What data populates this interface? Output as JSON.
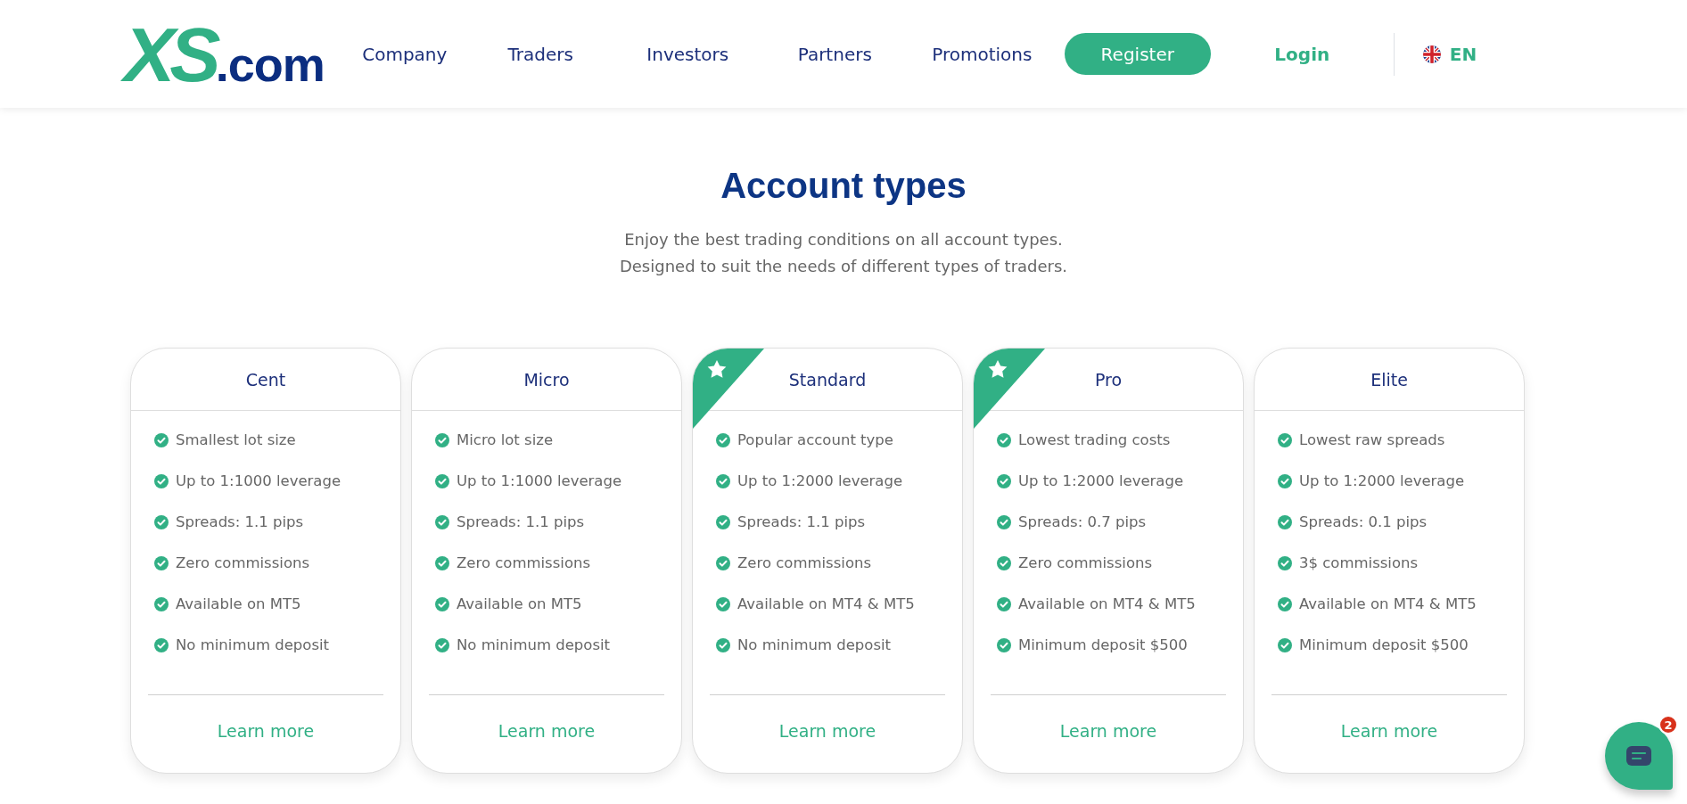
{
  "header": {
    "logo": {
      "mark": "XS",
      "suffix": ".com"
    },
    "nav": [
      "Company",
      "Traders",
      "Investors",
      "Partners",
      "Promotions"
    ],
    "register": "Register",
    "login": "Login",
    "language": "EN"
  },
  "section": {
    "title": "Account types",
    "subtitle": [
      "Enjoy the best trading conditions on all account types.",
      "Designed to suit the needs of different types of traders."
    ]
  },
  "cards": [
    {
      "name": "Cent",
      "featured": false,
      "features": [
        "Smallest lot size",
        "Up to 1:1000 leverage",
        "Spreads: 1.1 pips",
        "Zero commissions",
        "Available on MT5",
        "No minimum deposit"
      ],
      "link": "Learn more"
    },
    {
      "name": "Micro",
      "featured": false,
      "features": [
        "Micro lot size",
        "Up to 1:1000 leverage",
        "Spreads: 1.1 pips",
        "Zero commissions",
        "Available on MT5",
        "No minimum deposit"
      ],
      "link": "Learn more"
    },
    {
      "name": "Standard",
      "featured": true,
      "features": [
        "Popular account type",
        "Up to 1:2000 leverage",
        "Spreads: 1.1 pips",
        "Zero commissions",
        "Available on MT4 & MT5",
        "No minimum deposit"
      ],
      "link": "Learn more"
    },
    {
      "name": "Pro",
      "featured": true,
      "features": [
        "Lowest trading costs",
        "Up to 1:2000 leverage",
        "Spreads: 0.7 pips",
        "Zero commissions",
        "Available on MT4 & MT5",
        "Minimum deposit $500"
      ],
      "link": "Learn more"
    },
    {
      "name": "Elite",
      "featured": false,
      "features": [
        "Lowest raw spreads",
        "Up to 1:2000 leverage",
        "Spreads: 0.1 pips",
        "3$ commissions",
        "Available on MT4 & MT5",
        "Minimum deposit $500"
      ],
      "link": "Learn more"
    }
  ],
  "chat": {
    "badge": "2"
  }
}
